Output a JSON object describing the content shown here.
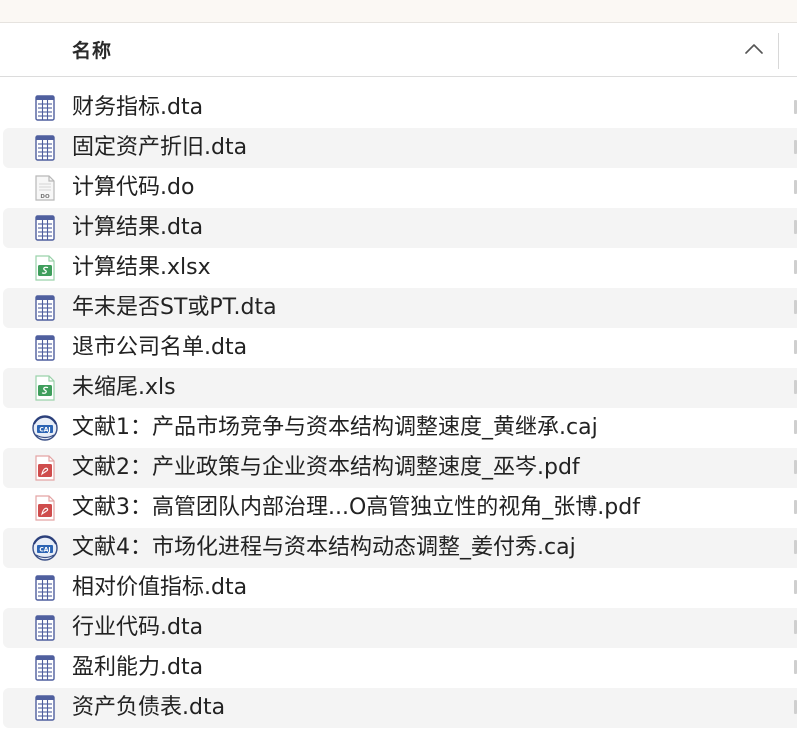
{
  "header": {
    "name_label": "名称"
  },
  "files": [
    {
      "name": "财务指标.dta",
      "icon": "dta-icon"
    },
    {
      "name": "固定资产折旧.dta",
      "icon": "dta-icon"
    },
    {
      "name": "计算代码.do",
      "icon": "do-icon"
    },
    {
      "name": "计算结果.dta",
      "icon": "dta-icon"
    },
    {
      "name": "计算结果.xlsx",
      "icon": "spreadsheet-icon"
    },
    {
      "name": "年末是否ST或PT.dta",
      "icon": "dta-icon"
    },
    {
      "name": "退市公司名单.dta",
      "icon": "dta-icon"
    },
    {
      "name": "未缩尾.xls",
      "icon": "spreadsheet-icon"
    },
    {
      "name": "文献1：产品市场竞争与资本结构调整速度_黄继承.caj",
      "icon": "caj-icon"
    },
    {
      "name": "文献2：产业政策与企业资本结构调整速度_巫岑.pdf",
      "icon": "pdf-icon"
    },
    {
      "name": "文献3：高管团队内部治理...O高管独立性的视角_张博.pdf",
      "icon": "pdf-icon"
    },
    {
      "name": "文献4：市场化进程与资本结构动态调整_姜付秀.caj",
      "icon": "caj-icon"
    },
    {
      "name": "相对价值指标.dta",
      "icon": "dta-icon"
    },
    {
      "name": "行业代码.dta",
      "icon": "dta-icon"
    },
    {
      "name": "盈利能力.dta",
      "icon": "dta-icon"
    },
    {
      "name": "资产负债表.dta",
      "icon": "dta-icon"
    }
  ],
  "colors": {
    "dta_icon": "#4f5f9e",
    "spreadsheet_icon": "#3f9e5c",
    "pdf_icon": "#cf4d4d",
    "caj_icon": "#2c64b4",
    "stripe": "#f4f4f4"
  }
}
